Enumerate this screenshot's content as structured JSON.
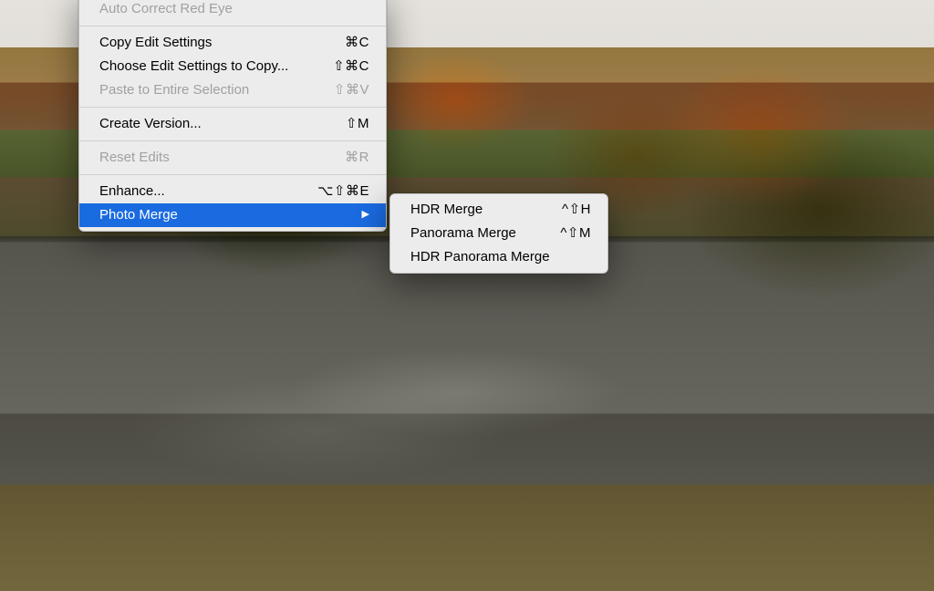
{
  "menu": {
    "main": {
      "items": [
        {
          "label": "Auto Correct Red Eye",
          "shortcut": "",
          "disabled": true
        },
        "sep",
        {
          "label": "Copy Edit Settings",
          "shortcut": "⌘C"
        },
        {
          "label": "Choose Edit Settings to Copy...",
          "shortcut": "⇧⌘C"
        },
        {
          "label": "Paste to Entire Selection",
          "shortcut": "⇧⌘V",
          "disabled": true
        },
        "sep",
        {
          "label": "Create Version...",
          "shortcut": "⇧M"
        },
        "sep",
        {
          "label": "Reset Edits",
          "shortcut": "⌘R",
          "disabled": true
        },
        "sep",
        {
          "label": "Enhance...",
          "shortcut": "⌥⇧⌘E"
        },
        {
          "label": "Photo Merge",
          "shortcut": "",
          "selected": true,
          "submenu": true
        }
      ]
    },
    "submenu": {
      "items": [
        {
          "label": "HDR Merge",
          "shortcut": "^⇧H"
        },
        {
          "label": "Panorama Merge",
          "shortcut": "^⇧M"
        },
        {
          "label": "HDR Panorama Merge",
          "shortcut": ""
        }
      ]
    }
  },
  "colors": {
    "highlight": "#1a6be0"
  }
}
